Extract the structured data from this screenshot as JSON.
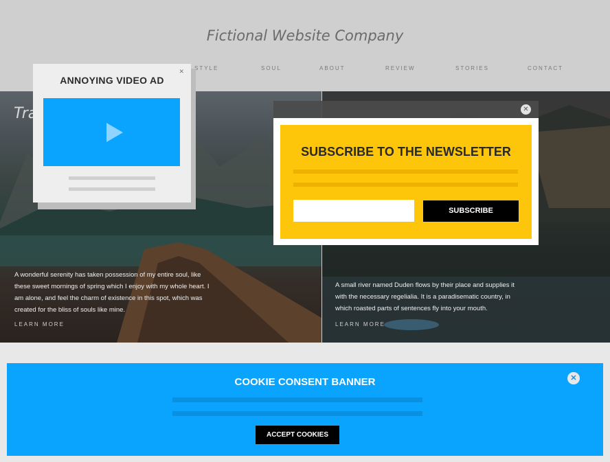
{
  "site": {
    "title": "Fictional Website Company"
  },
  "nav": {
    "items": [
      {
        "label": "STYLE"
      },
      {
        "label": "SOUL"
      },
      {
        "label": "ABOUT"
      },
      {
        "label": "REVIEW"
      },
      {
        "label": "STORIES"
      },
      {
        "label": "CONTACT"
      }
    ]
  },
  "hero": {
    "heading": "Tra",
    "left": {
      "text": "A wonderful serenity has taken possession of my entire soul, like these sweet mornings of spring which I enjoy with my whole heart. I am alone, and feel the charm of existence in this spot, which was created for the bliss of souls like mine.",
      "link": "LEARN MORE"
    },
    "right": {
      "text": "A small river named Duden flows by their place and supplies it with the necessary regelialia. It is a paradisematic country, in which roasted parts of sentences fly into your mouth.",
      "link": "LEARN MORE"
    }
  },
  "video_ad": {
    "title": "ANNOYING VIDEO AD",
    "close_icon": "close-icon",
    "play_icon": "play-icon"
  },
  "newsletter": {
    "title": "SUBSCRIBE TO THE NEWSLETTER",
    "email_value": "",
    "button": "SUBSCRIBE",
    "accent": "#fdc60a"
  },
  "cookie": {
    "title": "COOKIE CONSENT BANNER",
    "button": "ACCEPT COOKIES",
    "accent": "#0aa4ff"
  }
}
